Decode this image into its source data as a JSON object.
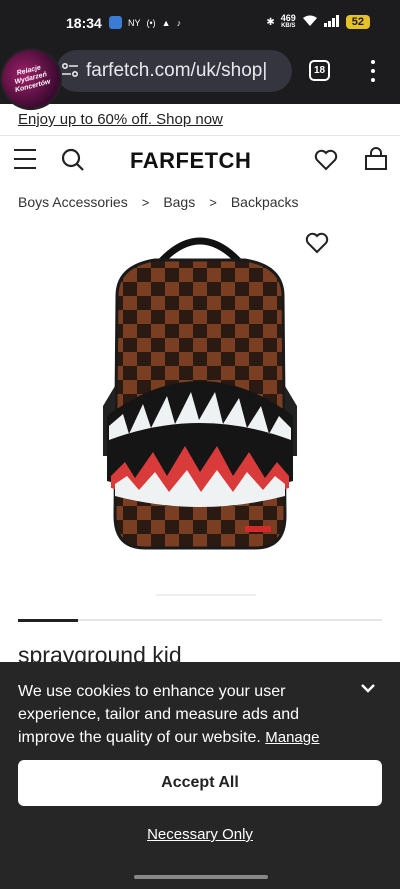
{
  "status": {
    "time": "18:34",
    "left_icons_text": "NY",
    "net_speed": "469",
    "net_unit": "KB/S",
    "battery": "52"
  },
  "browser": {
    "avatar_text": "Relacje Wydarzeń Koncertów",
    "url": "farfetch.com/uk/shop|",
    "tab_count": "18"
  },
  "promo": {
    "text": "Enjoy up to 60% off. Shop now"
  },
  "header": {
    "logo": "FARFETCH"
  },
  "breadcrumb": [
    "Boys Accessories",
    "Bags",
    "Backpacks"
  ],
  "product": {
    "brand": "sprayground kid"
  },
  "cookie": {
    "message": "We use cookies to enhance your user experience, tailor and measure ads and improve the quality of our website.",
    "manage_label": "Manage",
    "accept_label": "Accept All",
    "necessary_label": "Necessary Only"
  },
  "colors": {
    "dark_bar": "#1c1c1e",
    "cookie_bg": "#262626",
    "accent_battery": "#e6c229"
  }
}
